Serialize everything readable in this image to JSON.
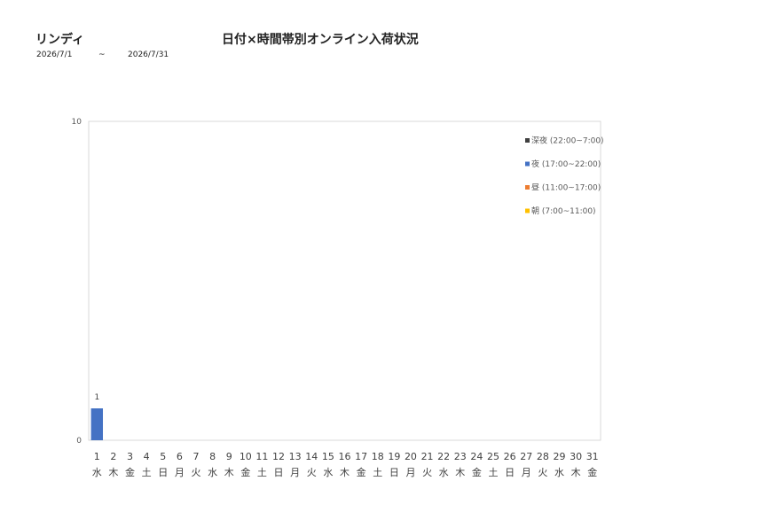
{
  "header": {
    "store_name": "リンディ",
    "title": "日付×時間帯別オンライン入荷状況",
    "date_from": "2026/7/1",
    "date_sep": "~",
    "date_to": "2026/7/31"
  },
  "chart_data": {
    "type": "bar",
    "stacked": true,
    "ylim": [
      0,
      10
    ],
    "yticks": [
      0,
      10
    ],
    "grid": false,
    "legend_position": "top-right",
    "categories": [
      "1",
      "2",
      "3",
      "4",
      "5",
      "6",
      "7",
      "8",
      "9",
      "10",
      "11",
      "12",
      "13",
      "14",
      "15",
      "16",
      "17",
      "18",
      "19",
      "20",
      "21",
      "22",
      "23",
      "24",
      "25",
      "26",
      "27",
      "28",
      "29",
      "30",
      "31"
    ],
    "weekdays": [
      "水",
      "木",
      "金",
      "土",
      "日",
      "月",
      "火",
      "水",
      "木",
      "金",
      "土",
      "日",
      "月",
      "火",
      "水",
      "木",
      "金",
      "土",
      "日",
      "月",
      "火",
      "水",
      "木",
      "金",
      "土",
      "日",
      "月",
      "火",
      "水",
      "木",
      "金"
    ],
    "series": [
      {
        "name": "朝 (7:00~11:00)",
        "color": "#FFC000",
        "values": [
          0,
          0,
          0,
          0,
          0,
          0,
          0,
          0,
          0,
          0,
          0,
          0,
          0,
          0,
          0,
          0,
          0,
          0,
          0,
          0,
          0,
          0,
          0,
          0,
          0,
          0,
          0,
          0,
          0,
          0,
          0
        ]
      },
      {
        "name": "昼 (11:00~17:00)",
        "color": "#ED7D31",
        "values": [
          0,
          0,
          0,
          0,
          0,
          0,
          0,
          0,
          0,
          0,
          0,
          0,
          0,
          0,
          0,
          0,
          0,
          0,
          0,
          0,
          0,
          0,
          0,
          0,
          0,
          0,
          0,
          0,
          0,
          0,
          0
        ]
      },
      {
        "name": "夜 (17:00~22:00)",
        "color": "#4472C4",
        "values": [
          1,
          0,
          0,
          0,
          0,
          0,
          0,
          0,
          0,
          0,
          0,
          0,
          0,
          0,
          0,
          0,
          0,
          0,
          0,
          0,
          0,
          0,
          0,
          0,
          0,
          0,
          0,
          0,
          0,
          0,
          0
        ]
      },
      {
        "name": "深夜 (22:00~7:00)",
        "color": "#404040",
        "values": [
          0,
          0,
          0,
          0,
          0,
          0,
          0,
          0,
          0,
          0,
          0,
          0,
          0,
          0,
          0,
          0,
          0,
          0,
          0,
          0,
          0,
          0,
          0,
          0,
          0,
          0,
          0,
          0,
          0,
          0,
          0
        ]
      }
    ],
    "data_labels": [
      1,
      0,
      0,
      0,
      0,
      0,
      0,
      0,
      0,
      0,
      0,
      0,
      0,
      0,
      0,
      0,
      0,
      0,
      0,
      0,
      0,
      0,
      0,
      0,
      0,
      0,
      0,
      0,
      0,
      0,
      0
    ],
    "legend_order": [
      "深夜 (22:00~7:00)",
      "夜 (17:00~22:00)",
      "昼 (11:00~17:00)",
      "朝 (7:00~11:00)"
    ]
  }
}
